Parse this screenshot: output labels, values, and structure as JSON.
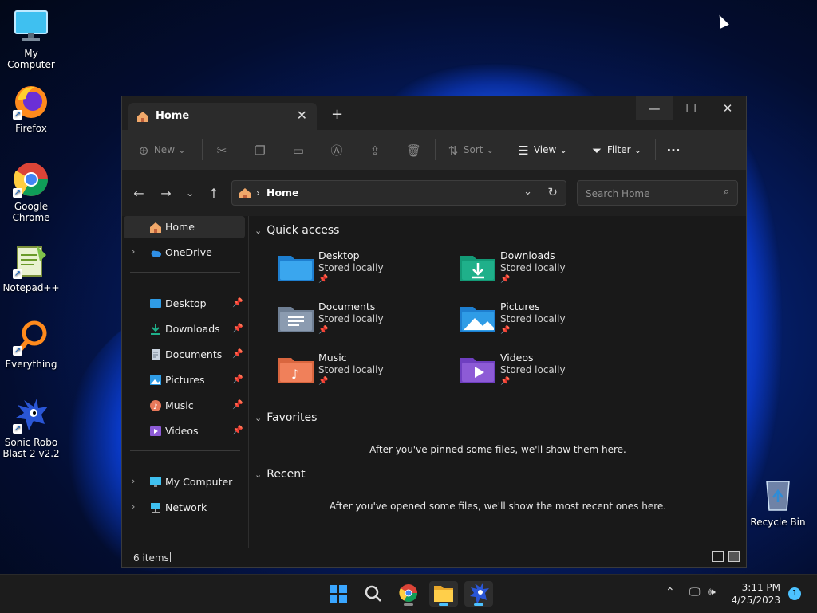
{
  "desktop": {
    "icons": [
      {
        "label": "My Computer"
      },
      {
        "label": "Firefox"
      },
      {
        "label": "Google Chrome"
      },
      {
        "label": "Notepad++"
      },
      {
        "label": "Everything"
      },
      {
        "label": "Sonic Robo Blast 2 v2.2"
      },
      {
        "label": "Recycle Bin"
      }
    ]
  },
  "window": {
    "tab_label": "Home",
    "toolbar": {
      "new_label": "New",
      "sort_label": "Sort",
      "view_label": "View",
      "filter_label": "Filter"
    },
    "address": {
      "crumb": "Home",
      "search_placeholder": "Search Home"
    },
    "nav": {
      "home": "Home",
      "onedrive": "OneDrive",
      "desktop": "Desktop",
      "downloads": "Downloads",
      "documents": "Documents",
      "pictures": "Pictures",
      "music": "Music",
      "videos": "Videos",
      "mycomputer": "My Computer",
      "network": "Network"
    },
    "sections": {
      "quick_access": "Quick access",
      "favorites": "Favorites",
      "recent": "Recent",
      "favorites_msg": "After you've pinned some files, we'll show them here.",
      "recent_msg": "After you've opened some files, we'll show the most recent ones here."
    },
    "quick_access": [
      {
        "name": "Desktop",
        "status": "Stored locally"
      },
      {
        "name": "Downloads",
        "status": "Stored locally"
      },
      {
        "name": "Documents",
        "status": "Stored locally"
      },
      {
        "name": "Pictures",
        "status": "Stored locally"
      },
      {
        "name": "Music",
        "status": "Stored locally"
      },
      {
        "name": "Videos",
        "status": "Stored locally"
      }
    ],
    "status": {
      "items": "6 items"
    }
  },
  "taskbar": {
    "time": "3:11 PM",
    "date": "4/25/2023",
    "notifications": "1"
  },
  "colors": {
    "accent": "#4cc2ff",
    "folder_blue": "#2f9ce6",
    "folder_green": "#1fb08a",
    "folder_gray": "#8b9bb0",
    "folder_music": "#f0805a",
    "folder_video": "#8d5bd6"
  }
}
